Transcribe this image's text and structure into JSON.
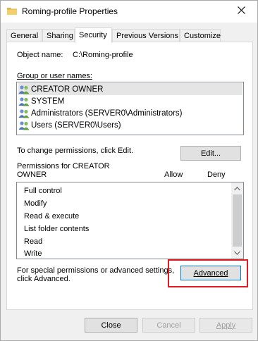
{
  "window": {
    "title": "Roming-profile Properties"
  },
  "tabs": [
    {
      "label": "General"
    },
    {
      "label": "Sharing"
    },
    {
      "label": "Security"
    },
    {
      "label": "Previous Versions"
    },
    {
      "label": "Customize"
    }
  ],
  "security": {
    "object_name_label": "Object name:",
    "object_name_value": "C:\\Roming-profile",
    "group_label": "Group or user names:",
    "groups": [
      {
        "label": "CREATOR OWNER",
        "selected": true
      },
      {
        "label": "SYSTEM",
        "selected": false
      },
      {
        "label": "Administrators (SERVER0\\Administrators)",
        "selected": false
      },
      {
        "label": "Users (SERVER0\\Users)",
        "selected": false
      }
    ],
    "change_text": "To change permissions, click Edit.",
    "edit_label": "Edit...",
    "permissions_label_line1": "Permissions for CREATOR",
    "permissions_label_line2": "OWNER",
    "allow_label": "Allow",
    "deny_label": "Deny",
    "permissions": [
      {
        "label": "Full control"
      },
      {
        "label": "Modify"
      },
      {
        "label": "Read & execute"
      },
      {
        "label": "List folder contents"
      },
      {
        "label": "Read"
      },
      {
        "label": "Write"
      }
    ],
    "special_text_line1": "For special permissions or advanced settings,",
    "special_text_line2": "click Advanced.",
    "advanced_label": "Advanced"
  },
  "footer": {
    "close_label": "Close",
    "cancel_label": "Cancel",
    "apply_label": "Apply"
  },
  "colors": {
    "highlight": "#e31b23",
    "folder": "#e8b84a"
  }
}
